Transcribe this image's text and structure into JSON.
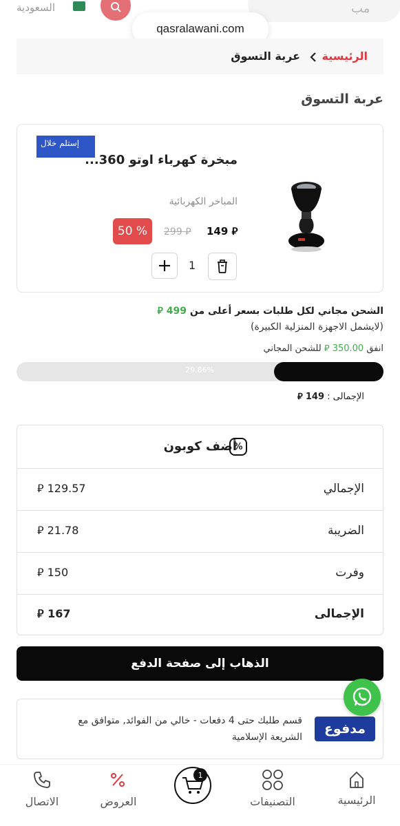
{
  "browser": {
    "url": "qasralawani.com"
  },
  "header": {
    "country": "السعودية",
    "search_right_text": "مب"
  },
  "breadcrumb": {
    "home": "الرئيسية",
    "current": "عربة التسوق"
  },
  "page": {
    "title": "عربة التسوق"
  },
  "product": {
    "promo_label": "إستلم خلال",
    "name": "مبخرة كهرباء اوتو 360...",
    "category": "المباخر الكهربائية",
    "price_new": "149",
    "price_old": "299",
    "discount": "50 %",
    "quantity": "1"
  },
  "shipping": {
    "line1_prefix": "الشحن مجاني لكل طلبات بسعر أعلى من",
    "line1_amount": "499",
    "line2": "(لايشمل الاجهزة المنزلية الكبيرة)",
    "spend_prefix": "انفق",
    "spend_amount": "350.00",
    "spend_suffix": "للشحن المجاني",
    "progress_label": "29.86%",
    "progress_fraction": 0.2986,
    "total_label": "الإجمالى :",
    "total_value": "149"
  },
  "summary": {
    "coupon_label": "أضف كوبون",
    "rows": [
      {
        "label": "الإجمالي",
        "value": "129.57"
      },
      {
        "label": "الضريبة",
        "value": "21.78"
      },
      {
        "label": "وفرت",
        "value": "150"
      },
      {
        "label": "الإجمالى",
        "value": "167"
      }
    ]
  },
  "checkout": {
    "label": "الذهاب إلى صفحة الدفع"
  },
  "madfu": {
    "text": "قسم طلبك حتى 4 دفعات - خالي من الفوائد, متوافق مع الشريعة الإسلامية",
    "logo": "مدفوع"
  },
  "bottom_nav": {
    "home": "الرئيسية",
    "categories": "التصنيفات",
    "cart_count": "1",
    "offers": "العروض",
    "contact": "الاتصال"
  },
  "colors": {
    "accent_red": "#e0383f",
    "green": "#3fae4a",
    "madfu_blue": "#1e3c9e",
    "black": "#0a0a0a"
  }
}
